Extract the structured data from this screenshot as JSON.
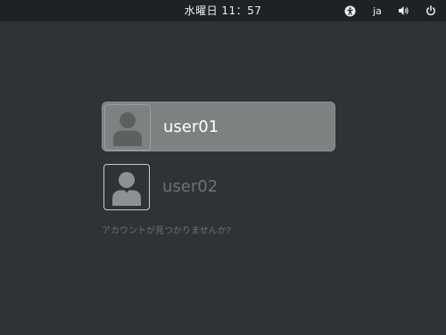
{
  "top_bar": {
    "clock": "水曜日  11：57",
    "language": "ja",
    "icons": {
      "accessibility": "accessibility-icon",
      "volume": "volume-icon",
      "power": "power-icon"
    }
  },
  "users": [
    {
      "name": "user01",
      "selected": true,
      "avatar_icon": "user-avatar-icon"
    },
    {
      "name": "user02",
      "selected": false,
      "avatar_icon": "user-avatar-icon"
    }
  ],
  "not_listed_link": "アカウントが見つかりませんか?",
  "colors": {
    "background": "#2e3436",
    "top_bar": "#1f2224",
    "selected_row": "#7e8182"
  }
}
